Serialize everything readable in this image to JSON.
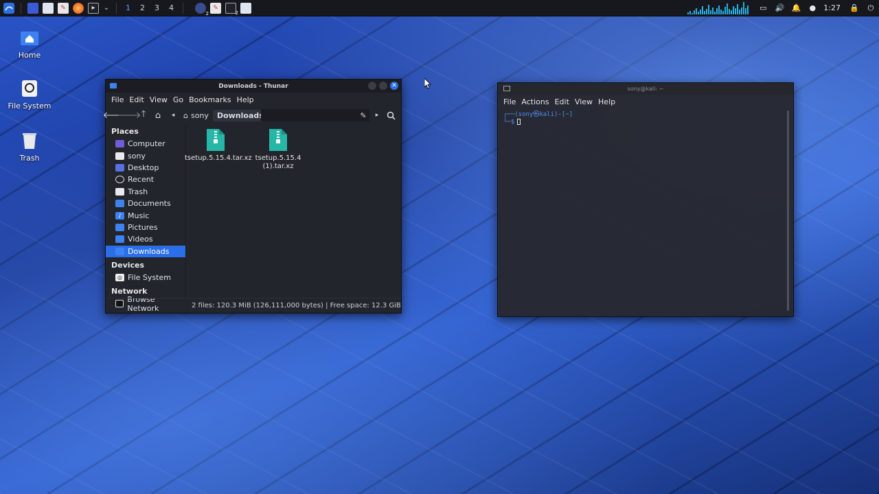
{
  "panel": {
    "workspaces": [
      "1",
      "2",
      "3",
      "4"
    ],
    "active_workspace": "1",
    "clock": "1:27",
    "badge_a": "2",
    "badge_b": "2"
  },
  "desktop_icons": [
    {
      "label": "Home",
      "icon": "home-icon"
    },
    {
      "label": "File System",
      "icon": "filesystem-icon"
    },
    {
      "label": "Trash",
      "icon": "trash-icon"
    }
  ],
  "thunar": {
    "title": "Downloads - Thunar",
    "menu": [
      "File",
      "Edit",
      "View",
      "Go",
      "Bookmarks",
      "Help"
    ],
    "path": [
      "sony",
      "Downloads"
    ],
    "sidebar": {
      "places_header": "Places",
      "places": [
        "Computer",
        "sony",
        "Desktop",
        "Recent",
        "Trash",
        "Documents",
        "Music",
        "Pictures",
        "Videos",
        "Downloads"
      ],
      "selected": "Downloads",
      "devices_header": "Devices",
      "devices": [
        "File System"
      ],
      "network_header": "Network",
      "network": [
        "Browse Network"
      ]
    },
    "files": [
      {
        "name": "tsetup.5.15.4.tar.xz"
      },
      {
        "name_line1": "tsetup.5.15.4",
        "name_line2": "(1).tar.xz"
      }
    ],
    "status": "2 files: 120.3 MiB (126,111,000 bytes)  |  Free space: 12.3 GiB"
  },
  "terminal": {
    "title": "sony@kali: ~",
    "menu": [
      "File",
      "Actions",
      "Edit",
      "View",
      "Help"
    ],
    "prompt_line1": "┌──(sony㉿kali)-[~]",
    "prompt_line2": "└─$"
  },
  "colors": {
    "accent": "#2b6fe8",
    "panel_bg": "#16181d",
    "window_bg": "#22252b",
    "archive_icon": "#27b7a8"
  }
}
